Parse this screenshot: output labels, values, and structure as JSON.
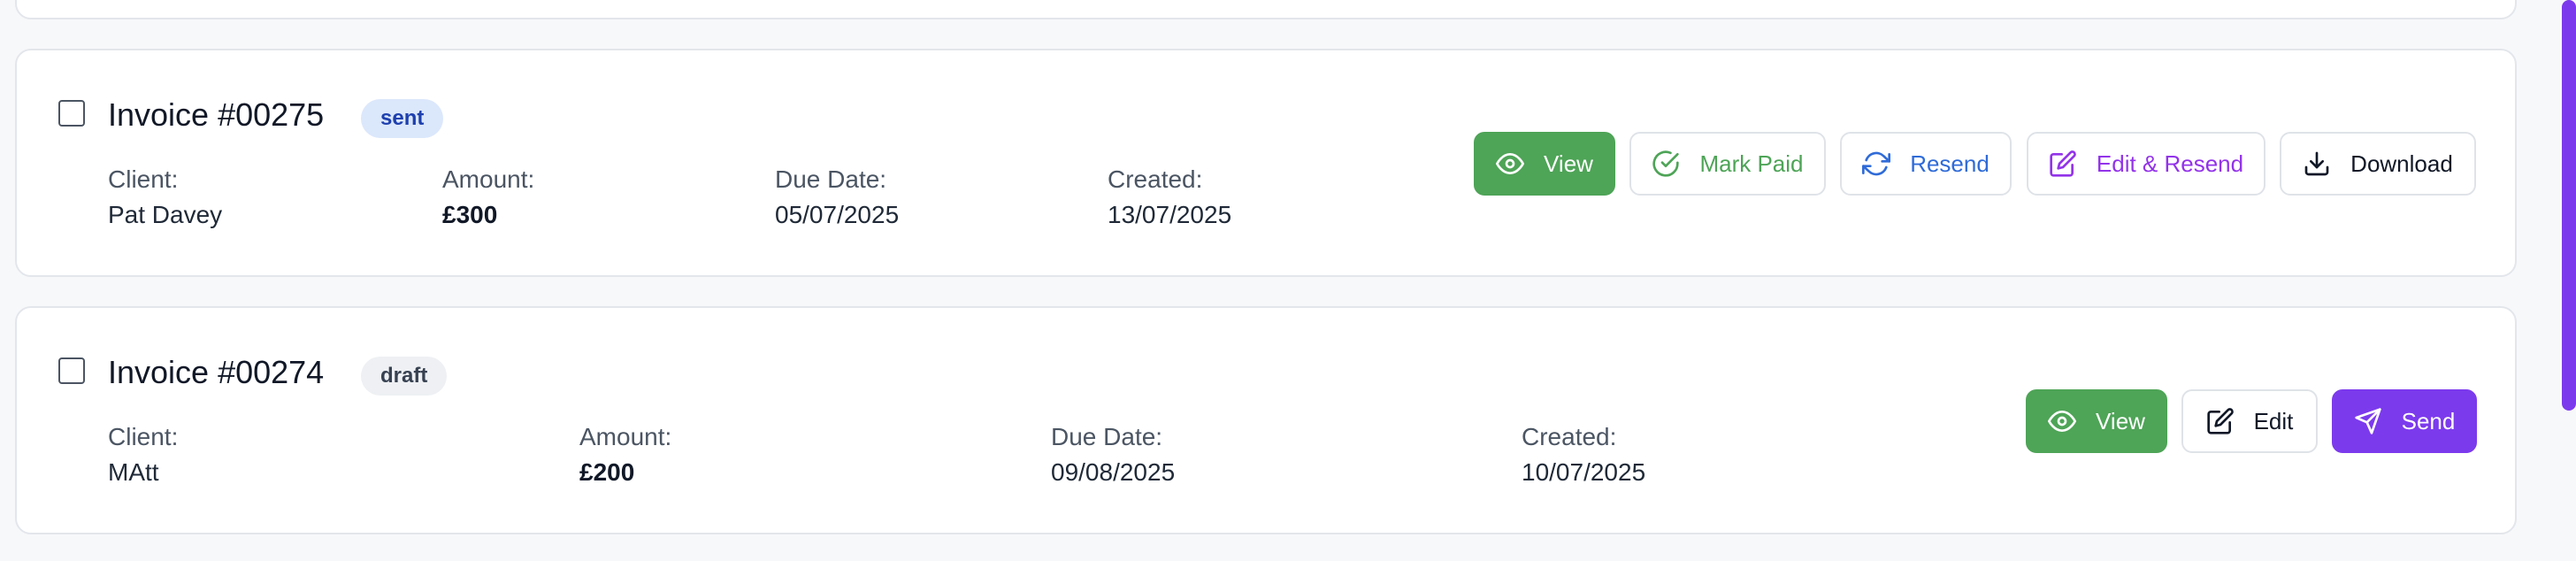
{
  "invoices": [
    {
      "title": "Invoice #00275",
      "status": "sent",
      "client_label": "Client:",
      "client": "Pat Davey",
      "amount_label": "Amount:",
      "amount": "£300",
      "due_label": "Due Date:",
      "due": "05/07/2025",
      "created_label": "Created:",
      "created": "13/07/2025",
      "actions": {
        "view": "View",
        "mark_paid": "Mark Paid",
        "resend": "Resend",
        "edit_resend": "Edit & Resend",
        "download": "Download"
      }
    },
    {
      "title": "Invoice #00274",
      "status": "draft",
      "client_label": "Client:",
      "client": "MAtt",
      "amount_label": "Amount:",
      "amount": "£200",
      "due_label": "Due Date:",
      "due": "09/08/2025",
      "created_label": "Created:",
      "created": "10/07/2025",
      "actions": {
        "view": "View",
        "edit": "Edit",
        "send": "Send"
      }
    }
  ],
  "icons": {
    "view": "eye-icon",
    "mark_paid": "check-circle-icon",
    "resend": "refresh-icon",
    "edit_resend": "edit-icon",
    "download": "download-icon",
    "edit": "edit-icon",
    "send": "send-icon"
  },
  "colors": {
    "primary_green": "#4ea457",
    "accent_purple": "#7c3aed",
    "resend_blue": "#2f6bd8",
    "edit_resend_purple": "#9333ea",
    "sent_badge_bg": "#dbe7fb",
    "draft_badge_bg": "#eef0f3"
  }
}
